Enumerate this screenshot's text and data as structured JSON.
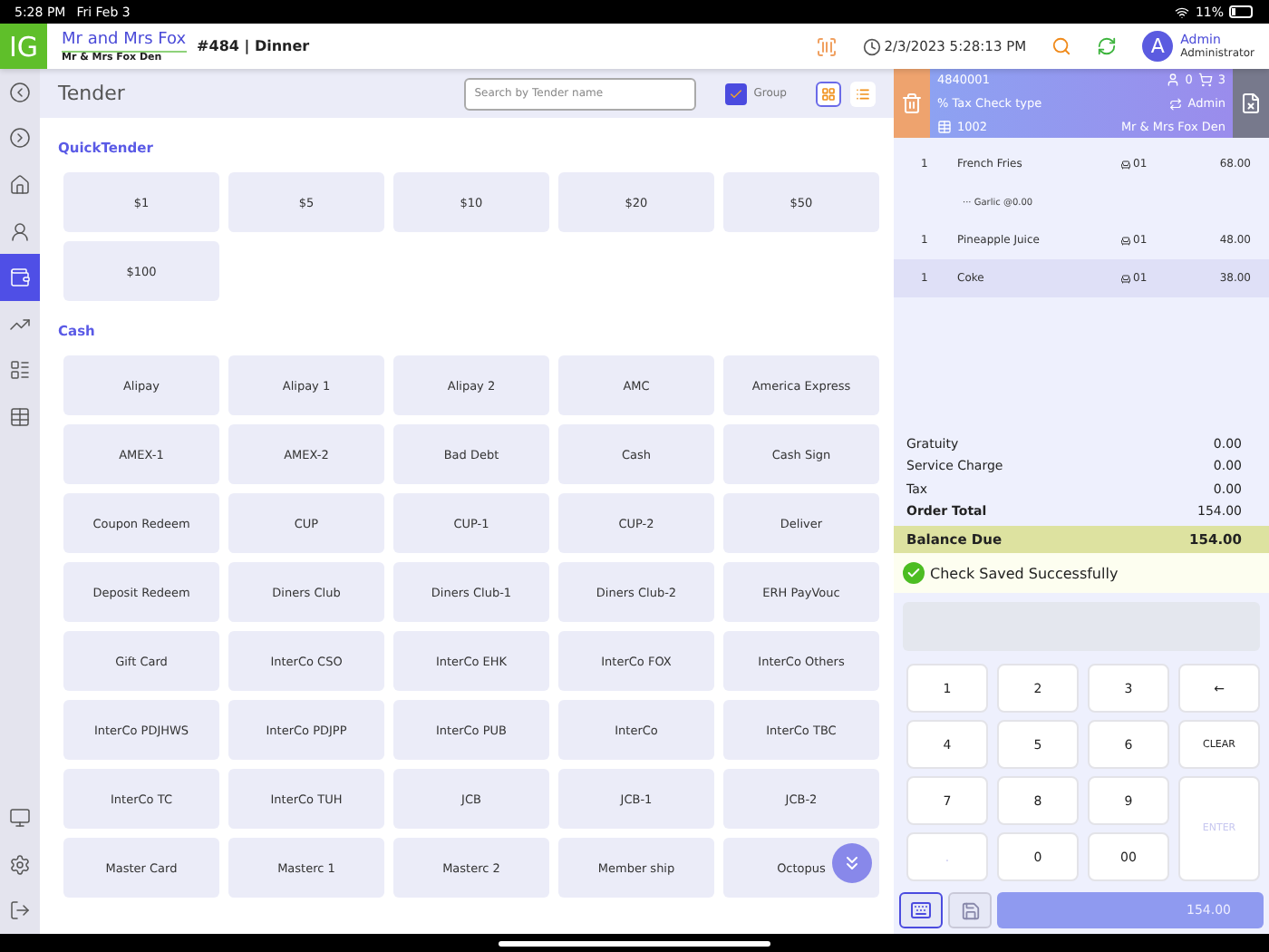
{
  "status_bar": {
    "time": "5:28 PM",
    "date": "Fri Feb 3",
    "battery": "11%"
  },
  "header": {
    "logo": "IG",
    "guest": "Mr and Mrs Fox",
    "venue": "Mr & Mrs Fox Den",
    "order": "#484 | Dinner",
    "datetime": "2/3/2023 5:28:13 PM",
    "avatar": "A",
    "user": "Admin",
    "role": "Administrator"
  },
  "sidebar": {
    "items": [
      {
        "selected": false
      },
      {
        "selected": false
      },
      {
        "selected": false
      },
      {
        "selected": false
      },
      {
        "selected": true
      },
      {
        "selected": false
      },
      {
        "selected": false
      },
      {
        "selected": false
      }
    ],
    "bottom": [
      {
        "selected": false
      },
      {
        "selected": false
      },
      {
        "selected": false
      }
    ]
  },
  "tender": {
    "title": "Tender",
    "search": {
      "placeholder": "Search by Tender name"
    },
    "group": {
      "label": "Group",
      "checked": true
    },
    "view": [
      {
        "kind": "grid",
        "selected": true
      },
      {
        "kind": "list",
        "selected": false
      }
    ],
    "sections": [
      {
        "title": "QuickTender",
        "items": [
          "$1",
          "$5",
          "$10",
          "$20",
          "$50",
          "$100"
        ]
      },
      {
        "title": "Cash",
        "items": [
          "Alipay",
          "Alipay 1",
          "Alipay 2",
          "AMC",
          "America Express",
          "AMEX-1",
          "AMEX-2",
          "Bad Debt",
          "Cash",
          "Cash Sign",
          "Coupon Redeem",
          "CUP",
          "CUP-1",
          "CUP-2",
          "Deliver",
          "Deposit Redeem",
          "Diners Club",
          "Diners Club-1",
          "Diners Club-2",
          "ERH PayVouc",
          "Gift Card",
          "InterCo CSO",
          "InterCo EHK",
          "InterCo FOX",
          "InterCo Others",
          "InterCo PDJHWS",
          "InterCo PDJPP",
          "InterCo PUB",
          "InterCo",
          "InterCo TBC",
          "InterCo TC",
          "InterCo TUH",
          "JCB",
          "JCB-1",
          "JCB-2",
          "Master Card",
          "Masterc 1",
          "Masterc 2",
          "Member ship",
          "Octopus"
        ]
      }
    ]
  },
  "check": {
    "number": "4840001",
    "guests": "0",
    "cart": "3",
    "check_type": "% Tax Check type",
    "server": "Admin",
    "table": "1002",
    "venue": "Mr & Mrs Fox Den",
    "items": [
      {
        "kind": "item",
        "qty": "1",
        "name": "French Fries",
        "seat": "01",
        "price": "68.00",
        "selected": false
      },
      {
        "kind": "modifier",
        "name": "··· Garlic @0.00",
        "selected": false
      },
      {
        "kind": "item",
        "qty": "1",
        "name": "Pineapple Juice",
        "seat": "01",
        "price": "48.00",
        "selected": false
      },
      {
        "kind": "item",
        "qty": "1",
        "name": "Coke",
        "seat": "01",
        "price": "38.00",
        "selected": true
      }
    ],
    "totals": [
      {
        "label": "Gratuity",
        "value": "0.00"
      },
      {
        "label": "Service Charge",
        "value": "0.00"
      },
      {
        "label": "Tax",
        "value": "0.00"
      },
      {
        "label": "Order Total",
        "value": "154.00"
      }
    ],
    "balance": {
      "label": "Balance Due",
      "value": "154.00"
    },
    "message": "Check Saved Successfully"
  },
  "keypad": [
    {
      "kind": "digit",
      "label": "1",
      "disabled": false
    },
    {
      "kind": "digit",
      "label": "2",
      "disabled": false
    },
    {
      "kind": "digit",
      "label": "3",
      "disabled": false
    },
    {
      "kind": "back",
      "label": "←",
      "disabled": false
    },
    {
      "kind": "digit",
      "label": "4",
      "disabled": false
    },
    {
      "kind": "digit",
      "label": "5",
      "disabled": false
    },
    {
      "kind": "digit",
      "label": "6",
      "disabled": false
    },
    {
      "kind": "clear",
      "label": "CLEAR",
      "disabled": false
    },
    {
      "kind": "digit",
      "label": "7",
      "disabled": false
    },
    {
      "kind": "digit",
      "label": "8",
      "disabled": false
    },
    {
      "kind": "digit",
      "label": "9",
      "disabled": false
    },
    {
      "kind": "enter",
      "label": "ENTER",
      "disabled": true
    },
    {
      "kind": "digit",
      "label": ".",
      "disabled": true
    },
    {
      "kind": "digit",
      "label": "0",
      "disabled": false
    },
    {
      "kind": "digit",
      "label": "00",
      "disabled": false
    }
  ],
  "footer": {
    "keyboard_selected": true,
    "amount": "154.00"
  }
}
